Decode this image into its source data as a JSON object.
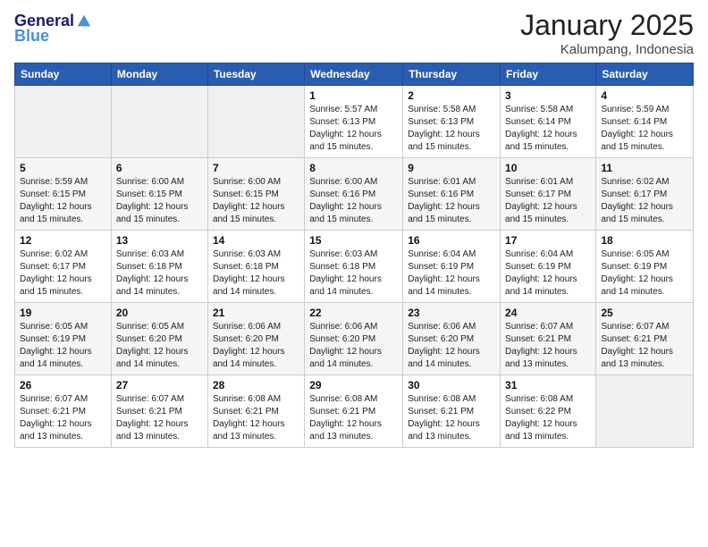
{
  "header": {
    "logo_line1": "General",
    "logo_line2": "Blue",
    "title": "January 2025",
    "subtitle": "Kalumpang, Indonesia"
  },
  "weekdays": [
    "Sunday",
    "Monday",
    "Tuesday",
    "Wednesday",
    "Thursday",
    "Friday",
    "Saturday"
  ],
  "weeks": [
    [
      {
        "day": "",
        "info": ""
      },
      {
        "day": "",
        "info": ""
      },
      {
        "day": "",
        "info": ""
      },
      {
        "day": "1",
        "info": "Sunrise: 5:57 AM\nSunset: 6:13 PM\nDaylight: 12 hours\nand 15 minutes."
      },
      {
        "day": "2",
        "info": "Sunrise: 5:58 AM\nSunset: 6:13 PM\nDaylight: 12 hours\nand 15 minutes."
      },
      {
        "day": "3",
        "info": "Sunrise: 5:58 AM\nSunset: 6:14 PM\nDaylight: 12 hours\nand 15 minutes."
      },
      {
        "day": "4",
        "info": "Sunrise: 5:59 AM\nSunset: 6:14 PM\nDaylight: 12 hours\nand 15 minutes."
      }
    ],
    [
      {
        "day": "5",
        "info": "Sunrise: 5:59 AM\nSunset: 6:15 PM\nDaylight: 12 hours\nand 15 minutes."
      },
      {
        "day": "6",
        "info": "Sunrise: 6:00 AM\nSunset: 6:15 PM\nDaylight: 12 hours\nand 15 minutes."
      },
      {
        "day": "7",
        "info": "Sunrise: 6:00 AM\nSunset: 6:15 PM\nDaylight: 12 hours\nand 15 minutes."
      },
      {
        "day": "8",
        "info": "Sunrise: 6:00 AM\nSunset: 6:16 PM\nDaylight: 12 hours\nand 15 minutes."
      },
      {
        "day": "9",
        "info": "Sunrise: 6:01 AM\nSunset: 6:16 PM\nDaylight: 12 hours\nand 15 minutes."
      },
      {
        "day": "10",
        "info": "Sunrise: 6:01 AM\nSunset: 6:17 PM\nDaylight: 12 hours\nand 15 minutes."
      },
      {
        "day": "11",
        "info": "Sunrise: 6:02 AM\nSunset: 6:17 PM\nDaylight: 12 hours\nand 15 minutes."
      }
    ],
    [
      {
        "day": "12",
        "info": "Sunrise: 6:02 AM\nSunset: 6:17 PM\nDaylight: 12 hours\nand 15 minutes."
      },
      {
        "day": "13",
        "info": "Sunrise: 6:03 AM\nSunset: 6:18 PM\nDaylight: 12 hours\nand 14 minutes."
      },
      {
        "day": "14",
        "info": "Sunrise: 6:03 AM\nSunset: 6:18 PM\nDaylight: 12 hours\nand 14 minutes."
      },
      {
        "day": "15",
        "info": "Sunrise: 6:03 AM\nSunset: 6:18 PM\nDaylight: 12 hours\nand 14 minutes."
      },
      {
        "day": "16",
        "info": "Sunrise: 6:04 AM\nSunset: 6:19 PM\nDaylight: 12 hours\nand 14 minutes."
      },
      {
        "day": "17",
        "info": "Sunrise: 6:04 AM\nSunset: 6:19 PM\nDaylight: 12 hours\nand 14 minutes."
      },
      {
        "day": "18",
        "info": "Sunrise: 6:05 AM\nSunset: 6:19 PM\nDaylight: 12 hours\nand 14 minutes."
      }
    ],
    [
      {
        "day": "19",
        "info": "Sunrise: 6:05 AM\nSunset: 6:19 PM\nDaylight: 12 hours\nand 14 minutes."
      },
      {
        "day": "20",
        "info": "Sunrise: 6:05 AM\nSunset: 6:20 PM\nDaylight: 12 hours\nand 14 minutes."
      },
      {
        "day": "21",
        "info": "Sunrise: 6:06 AM\nSunset: 6:20 PM\nDaylight: 12 hours\nand 14 minutes."
      },
      {
        "day": "22",
        "info": "Sunrise: 6:06 AM\nSunset: 6:20 PM\nDaylight: 12 hours\nand 14 minutes."
      },
      {
        "day": "23",
        "info": "Sunrise: 6:06 AM\nSunset: 6:20 PM\nDaylight: 12 hours\nand 14 minutes."
      },
      {
        "day": "24",
        "info": "Sunrise: 6:07 AM\nSunset: 6:21 PM\nDaylight: 12 hours\nand 13 minutes."
      },
      {
        "day": "25",
        "info": "Sunrise: 6:07 AM\nSunset: 6:21 PM\nDaylight: 12 hours\nand 13 minutes."
      }
    ],
    [
      {
        "day": "26",
        "info": "Sunrise: 6:07 AM\nSunset: 6:21 PM\nDaylight: 12 hours\nand 13 minutes."
      },
      {
        "day": "27",
        "info": "Sunrise: 6:07 AM\nSunset: 6:21 PM\nDaylight: 12 hours\nand 13 minutes."
      },
      {
        "day": "28",
        "info": "Sunrise: 6:08 AM\nSunset: 6:21 PM\nDaylight: 12 hours\nand 13 minutes."
      },
      {
        "day": "29",
        "info": "Sunrise: 6:08 AM\nSunset: 6:21 PM\nDaylight: 12 hours\nand 13 minutes."
      },
      {
        "day": "30",
        "info": "Sunrise: 6:08 AM\nSunset: 6:21 PM\nDaylight: 12 hours\nand 13 minutes."
      },
      {
        "day": "31",
        "info": "Sunrise: 6:08 AM\nSunset: 6:22 PM\nDaylight: 12 hours\nand 13 minutes."
      },
      {
        "day": "",
        "info": ""
      }
    ]
  ]
}
